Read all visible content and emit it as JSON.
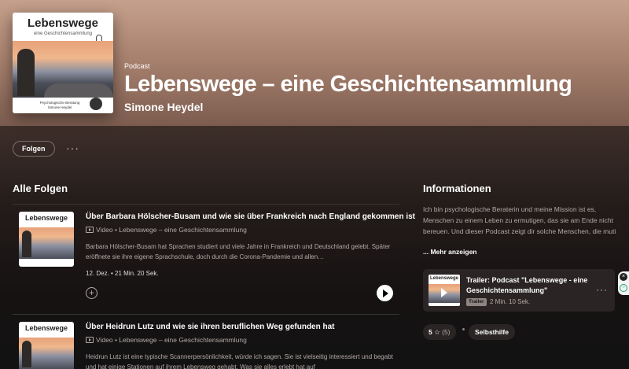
{
  "podcast": {
    "cover_title": "Lebenswege",
    "cover_subtitle": "eine Geschichtensammlung",
    "cover_footer": "Psychologische Beratung Simone Heydel",
    "kind_label": "Podcast",
    "title": "Lebenswege – eine Geschichtensammlung",
    "author": "Simone Heydel"
  },
  "actions": {
    "follow_label": "Folgen",
    "more_label": "···"
  },
  "episodes_section": {
    "title": "Alle Folgen",
    "episodes": [
      {
        "thumb_title": "Lebenswege",
        "title": "Über Barbara Hölscher-Busam und wie sie über Frankreich nach England gekommen ist",
        "meta": "Video • Lebenswege – eine Geschichtensammlung",
        "desc": "Barbara Hölscher-Busam hat Sprachen studiert und viele Jahre in Frankreich und Deutschland gelebt. Später eröffnete sie ihre eigene Sprachschule, doch durch die Corona-Pandemie und allen…",
        "date": "12. Dez. • 21 Min. 20 Sek."
      },
      {
        "thumb_title": "Lebenswege",
        "title": "Über Heidrun Lutz und wie sie ihren beruflichen Weg gefunden hat",
        "meta": "Video • Lebenswege – eine Geschichtensammlung",
        "desc": "Heidrun Lutz ist eine typische Scannerpersönlichkeit, würde ich sagen. Sie ist vielseitig interessiert und begabt und hat einige Stationen auf ihrem Lebensweg gehabt. Was sie alles erlebt hat auf"
      }
    ]
  },
  "info_section": {
    "title": "Informationen",
    "text": "Ich bin psychologische Beraterin und meine Mission ist es, Menschen zu einem Leben zu ermutigen, das sie am Ende nicht bereuen. Und dieser Podcast zeigt dir solche Menschen, die muti",
    "show_more": "... Mehr anzeigen",
    "trailer": {
      "thumb_title": "Lebenswege",
      "title": "Trailer: Podcast \"Lebenswege - eine Geschichtensammlung\"",
      "badge": "Trailer",
      "duration": "2 Min. 10 Sek."
    },
    "rating": {
      "value": "5",
      "star": "☆",
      "count": "(5)"
    },
    "category": "Selbsthilfe"
  },
  "colors": {
    "background": "#121212",
    "hero_top": "#c5a08c",
    "card": "#2a2524",
    "muted_text": "#b3aaa7"
  }
}
